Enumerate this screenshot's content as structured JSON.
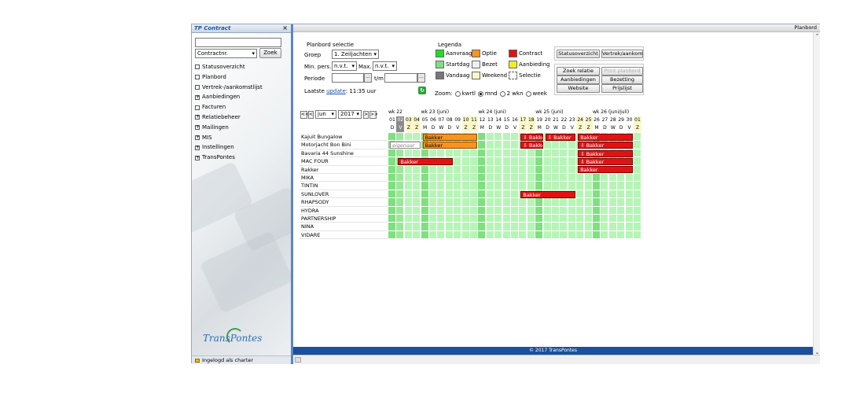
{
  "sidebar": {
    "title": "TP Contract",
    "close": "×",
    "search_select": "Contractnr.",
    "search_button": "Zoek",
    "items": [
      {
        "label": "Statusoverzicht",
        "icon": "page-icon",
        "expand": ""
      },
      {
        "label": "Planbord",
        "icon": "page-icon",
        "expand": ""
      },
      {
        "label": "Vertrek-/aankomstlijst",
        "icon": "page-icon",
        "expand": ""
      },
      {
        "label": "Aanbiedingen",
        "icon": "plus-icon",
        "expand": "+"
      },
      {
        "label": "Facturen",
        "icon": "page-icon",
        "expand": ""
      },
      {
        "label": "Relatiebeheer",
        "icon": "plus-icon",
        "expand": "+"
      },
      {
        "label": "Mailingen",
        "icon": "plus-icon",
        "expand": "+"
      },
      {
        "label": "MIS",
        "icon": "plus-icon",
        "expand": "+"
      },
      {
        "label": "Instellingen",
        "icon": "plus-icon",
        "expand": "+"
      },
      {
        "label": "TransPontes",
        "icon": "plus-icon",
        "expand": "+"
      }
    ],
    "logo": "TransPontes",
    "status": "Ingelogd als charter"
  },
  "main": {
    "title": "Planbord",
    "footer": "© 2017 TransPontes"
  },
  "selection": {
    "title": "Planbord selectie",
    "groep_label": "Groep",
    "groep_value": "1. Zeiljachten",
    "minpers_label": "Min. pers.",
    "minpers_value": "n.v.t.",
    "max_label": "Max.",
    "max_value": "n.v.t.",
    "periode_label": "Periode",
    "tm_label": "t/m",
    "dots": "...",
    "update_prefix": "Laatste",
    "update_link": "update",
    "update_time": ": 11:35 uur",
    "refresh": "↻"
  },
  "legend": {
    "title": "Legenda",
    "items": [
      {
        "label": "Aanvraag",
        "color": "#22dd22"
      },
      {
        "label": "Optie",
        "color": "#f7931e"
      },
      {
        "label": "Contract",
        "color": "#e31212"
      },
      {
        "label": "Startdag",
        "color": "#7fe07f"
      },
      {
        "label": "Bezet",
        "color": "#f0f0f0"
      },
      {
        "label": "Aanbieding",
        "color": "#f2ee1a"
      },
      {
        "label": "Vandaag",
        "color": "#777777"
      },
      {
        "label": "Weekend",
        "color": "#fbf7c8"
      },
      {
        "label": "Selectie",
        "color": "#ffffff"
      }
    ],
    "zoom_label": "Zoom:",
    "zoom_options": [
      "kwrtl",
      "mnd",
      "2 wkn",
      "week"
    ],
    "zoom_selected": 1
  },
  "buttons": {
    "statusoverzicht": "Statusoverzicht",
    "vertrek": "Vertrek/aankomst",
    "zoek_relatie": "Zoek relatie",
    "print": "Print planbord",
    "aanbiedingen": "Aanbiedingen",
    "bezetting": "Bezetting",
    "website": "Website",
    "prijslijst": "Prijslijst"
  },
  "planbord": {
    "nav": {
      "first": "<<",
      "prev": "<",
      "month": "jun",
      "year": "2017",
      "next": ">",
      "last": ">>"
    },
    "weeks": [
      {
        "label": "wk 22",
        "col": 0
      },
      {
        "label": "wk 23 (juni)",
        "col": 4
      },
      {
        "label": "wk 24 (juni)",
        "col": 11
      },
      {
        "label": "wk 25 (juni)",
        "col": 18
      },
      {
        "label": "wk 26 (juni/juli)",
        "col": 25
      }
    ],
    "days": [
      "01",
      "02",
      "03",
      "04",
      "05",
      "06",
      "07",
      "08",
      "09",
      "10",
      "11",
      "12",
      "13",
      "14",
      "15",
      "16",
      "17",
      "18",
      "19",
      "20",
      "21",
      "22",
      "23",
      "24",
      "25",
      "26",
      "27",
      "28",
      "29",
      "30",
      "01"
    ],
    "weekdays": [
      "D",
      "V",
      "Z",
      "Z",
      "M",
      "D",
      "W",
      "D",
      "V",
      "Z",
      "Z",
      "M",
      "D",
      "W",
      "D",
      "V",
      "Z",
      "Z",
      "M",
      "D",
      "W",
      "D",
      "V",
      "Z",
      "Z",
      "M",
      "D",
      "W",
      "D",
      "V",
      "Z"
    ],
    "today_index": 1,
    "boats": [
      "Kajuit Bungalow",
      "Motorjacht Bon Bini",
      "Bavaria 44 Sunshine",
      "MAC FOUR",
      "Rakker",
      "MIKA",
      "TINTIN",
      "SUNLOVER",
      "RHAPSODY",
      "HYDRA",
      "PARTNERSHIP",
      "NINA",
      "VIDARE"
    ],
    "bookings": [
      {
        "row": 0,
        "start": 4,
        "end": 10,
        "type": "opt",
        "label": "Bakker"
      },
      {
        "row": 0,
        "start": 16,
        "end": 18,
        "type": "con",
        "label": "⇩ Bakker"
      },
      {
        "row": 0,
        "start": 19,
        "end": 22,
        "type": "con",
        "label": "⇩ Bakker"
      },
      {
        "row": 0,
        "start": 23,
        "end": 29,
        "type": "con",
        "label": "Bakker"
      },
      {
        "row": 1,
        "start": 0,
        "end": 3,
        "type": "ph",
        "label": "eigenaar"
      },
      {
        "row": 1,
        "start": 4,
        "end": 10,
        "type": "opt",
        "label": "Bakker"
      },
      {
        "row": 1,
        "start": 16,
        "end": 18,
        "type": "con",
        "label": "⇩ Bakker"
      },
      {
        "row": 1,
        "start": 23,
        "end": 29,
        "type": "con",
        "label": "⇩ Bakker"
      },
      {
        "row": 2,
        "start": 23,
        "end": 29,
        "type": "con",
        "label": "⇩ Bakker"
      },
      {
        "row": 3,
        "start": 1,
        "end": 7,
        "type": "con",
        "label": "Bakker"
      },
      {
        "row": 3,
        "start": 23,
        "end": 29,
        "type": "con",
        "label": "⇩ Bakker"
      },
      {
        "row": 4,
        "start": 23,
        "end": 29,
        "type": "con",
        "label": "Bakker"
      },
      {
        "row": 7,
        "start": 16,
        "end": 22,
        "type": "con",
        "label": "Bakker"
      }
    ]
  }
}
